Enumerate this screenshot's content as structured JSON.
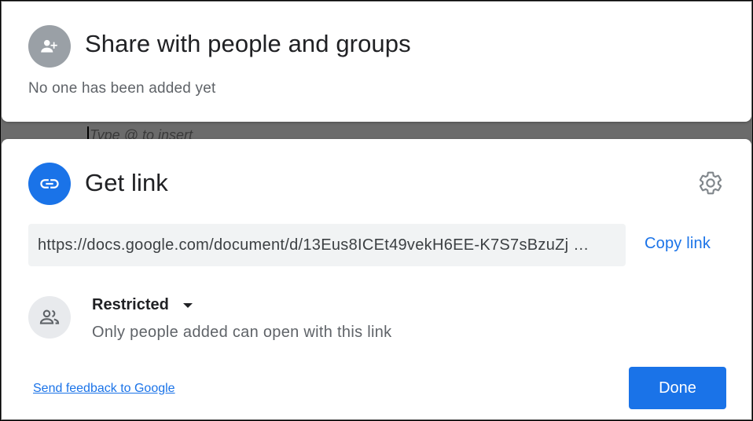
{
  "backdrop": {
    "placeholder": "Type @ to insert"
  },
  "share": {
    "title": "Share with people and groups",
    "empty_message": "No one has been added yet",
    "icon": "person-add-icon"
  },
  "get_link": {
    "title": "Get link",
    "icon": "link-icon",
    "settings_icon": "gear-icon",
    "url": "https://docs.google.com/document/d/13Eus8ICEt49vekH6EE-K7S7sBzuZj …",
    "copy_label": "Copy link",
    "access": {
      "icon": "people-icon",
      "level": "Restricted",
      "description": "Only people added can open with this link"
    },
    "feedback_label": "Send feedback to Google",
    "done_label": "Done"
  },
  "colors": {
    "accent": "#1a73e8",
    "muted_text": "#5f6368",
    "url_bg": "#f1f3f4"
  }
}
